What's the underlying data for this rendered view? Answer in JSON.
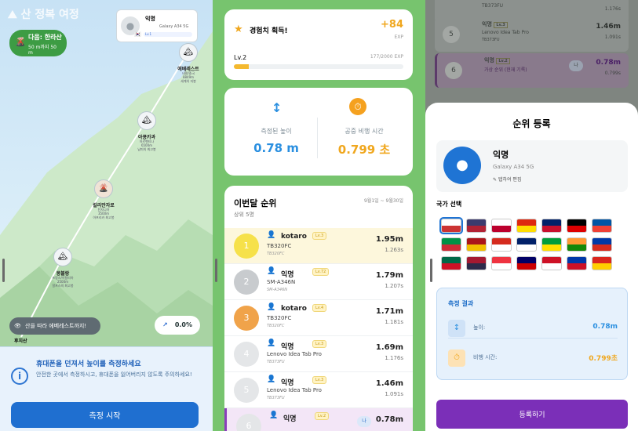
{
  "screen1": {
    "app_title": "산 정복 여정",
    "next": {
      "label": "다음: 한라산",
      "sub": "50 m까지 50 m"
    },
    "user": {
      "name": "익명",
      "device": "Galaxy A34 5G",
      "level": "Lv.1"
    },
    "mountains": [
      {
        "name": "에베레스트",
        "sub": "네팔/중국",
        "height": "8849m",
        "extra": "세계의 지붕"
      },
      {
        "name": "아콩카과",
        "sub": "아르헨티나",
        "height": "6500m",
        "extra": "남미의 최고봉"
      },
      {
        "name": "킬리만자로",
        "sub": "탄자니아",
        "height": "3500m",
        "extra": "아프리카 최고봉"
      },
      {
        "name": "몽블랑",
        "sub": "프랑스/이탈리아",
        "height": "2500m",
        "extra": "알프스의 최고봉"
      }
    ],
    "start_label": "후지산",
    "tip": "산을 따라 에베레스트까지!",
    "progress": "0.0%",
    "info": {
      "title": "휴대폰을 던져서 높이를 측정하세요",
      "body": "안전한 곳에서 측정하시고, 휴대폰을 잃어버리지 않도록 주의하세요!"
    },
    "start_button": "측정 시작"
  },
  "screen2": {
    "xp": {
      "title": "경험치 획득!",
      "plus": "+84",
      "unit": "EXP",
      "level": "Lv.2",
      "value": "177/2000 EXP",
      "fraction": 0.0885
    },
    "result": {
      "height_label": "측정된 높이",
      "height_value": "0.78 m",
      "time_label": "공중 비행 시간",
      "time_value": "0.799 초"
    },
    "ranking": {
      "title": "이번달 순위",
      "dates": "9월1일 ~ 9월30일",
      "subtitle": "상위 5명",
      "rows": [
        {
          "rank": "1",
          "name": "kotaro",
          "level": "Lv.3",
          "device": "TB320FC",
          "model": "TB320FC",
          "height": "1.95m",
          "time": "1.263s",
          "color": "#f6e14a"
        },
        {
          "rank": "2",
          "name": "익명",
          "level": "Lv.72",
          "device": "SM-A346N",
          "model": "SM-A346N",
          "height": "1.79m",
          "time": "1.207s",
          "color": "#c8cbce"
        },
        {
          "rank": "3",
          "name": "kotaro",
          "level": "Lv.4",
          "device": "TB320FC",
          "model": "TB320FC",
          "height": "1.71m",
          "time": "1.181s",
          "color": "#f0a34a"
        },
        {
          "rank": "4",
          "name": "익명",
          "level": "Lv.3",
          "device": "Lenovo Idea Tab Pro",
          "model": "TB373FU",
          "height": "1.69m",
          "time": "1.176s",
          "color": "#e4e6e8"
        },
        {
          "rank": "5",
          "name": "익명",
          "level": "Lv.3",
          "device": "Lenovo Idea Tab Pro",
          "model": "TB373FU",
          "height": "1.46m",
          "time": "1.091s",
          "color": "#e4e6e8"
        },
        {
          "rank": "6",
          "name": "익명",
          "level": "Lv.2",
          "badge": "나",
          "height": "0.78m",
          "color": "#e4e6e8"
        }
      ]
    }
  },
  "screen3": {
    "bg_rows": [
      {
        "n": "",
        "name": "",
        "device": "TB373FU",
        "height": "",
        "time": "1.176s"
      },
      {
        "n": "5",
        "name": "익명",
        "level": "Lv.3",
        "device": "Lenovo Idea Tab Pro",
        "model": "TB373FU",
        "height": "1.46m",
        "time": "1.091s"
      },
      {
        "n": "6",
        "name": "익명",
        "level": "Lv.2",
        "badge": "나",
        "device": "가상 순위 (현재 기록)",
        "height": "0.78m",
        "time": "0.799s"
      }
    ],
    "modal": {
      "title": "순위 등록",
      "user_name": "익명",
      "user_device": "Galaxy A34 5G",
      "edit_label": "탭하여 편집",
      "country_label": "국가 선택",
      "flags": [
        "KR",
        "US",
        "JP",
        "CN",
        "GB",
        "DE",
        "FR",
        "IT",
        "ES",
        "CA",
        "AU",
        "BR",
        "IN",
        "RU",
        "MX",
        "TH",
        "SG",
        "MY",
        "ID",
        "PH",
        "VN"
      ],
      "result_title": "측정 결과",
      "height_label": "높이:",
      "height_value": "0.78m",
      "time_label": "비행 시간:",
      "time_value": "0.799초",
      "register_button": "등록하기"
    }
  }
}
